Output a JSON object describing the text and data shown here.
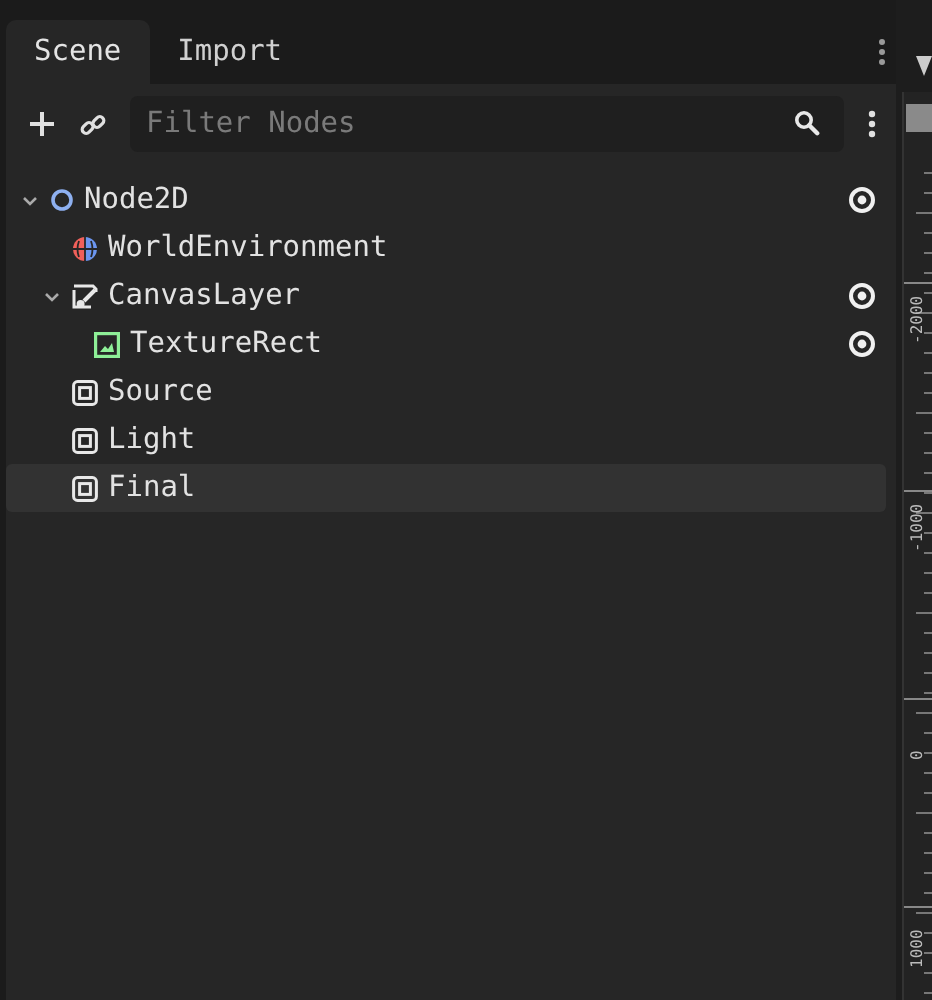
{
  "tabs": [
    {
      "label": "Scene",
      "selected": true
    },
    {
      "label": "Import",
      "selected": false
    }
  ],
  "filter": {
    "placeholder": "Filter Nodes"
  },
  "tree": [
    {
      "name": "Node2D",
      "kind": "node2d",
      "expanded": true,
      "visibility_toggle": true,
      "selected": false,
      "children": [
        {
          "name": "WorldEnvironment",
          "kind": "environment",
          "visibility_toggle": false,
          "selected": false
        },
        {
          "name": "CanvasLayer",
          "kind": "canvas-layer",
          "expanded": true,
          "visibility_toggle": true,
          "selected": false,
          "children": [
            {
              "name": "TextureRect",
              "kind": "texture-rect",
              "visibility_toggle": true,
              "selected": false
            }
          ]
        },
        {
          "name": "Source",
          "kind": "control",
          "visibility_toggle": false,
          "selected": false
        },
        {
          "name": "Light",
          "kind": "control",
          "visibility_toggle": false,
          "selected": false
        },
        {
          "name": "Final",
          "kind": "control",
          "visibility_toggle": false,
          "selected": true
        }
      ]
    }
  ],
  "ruler": {
    "labels": [
      "-2000",
      "-1000",
      "0",
      "1000"
    ]
  }
}
